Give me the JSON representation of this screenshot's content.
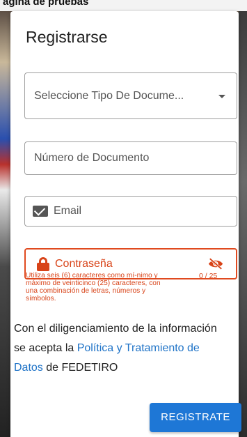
{
  "background": {
    "top_text": "agina de pruebas"
  },
  "dialog": {
    "title": "Registrarse",
    "fields": {
      "document_type": {
        "placeholder": "Seleccione Tipo De Docume..."
      },
      "document_number": {
        "placeholder": "Número de Documento"
      },
      "email": {
        "placeholder": "Email",
        "icon": "mail-icon"
      },
      "password": {
        "placeholder": "Contraseña",
        "icon": "lock-icon",
        "toggle_icon": "eye-off-icon",
        "helper": "Utiliza seis (6) caracteres como mí-nimo y máximo de veinticinco (25) caracteres, con una combinación de letras, números y símbolos.",
        "counter": "0 / 25"
      }
    },
    "consent": {
      "text_before": "Con el diligenciamiento de la información se acepta la ",
      "link_text": "Política y Tratamiento de Datos",
      "text_after": " de FEDETIRO"
    },
    "submit_label": "REGISTRATE"
  },
  "colors": {
    "error": "#d84318",
    "link": "#1f73c7",
    "button": "#1e77d6"
  }
}
